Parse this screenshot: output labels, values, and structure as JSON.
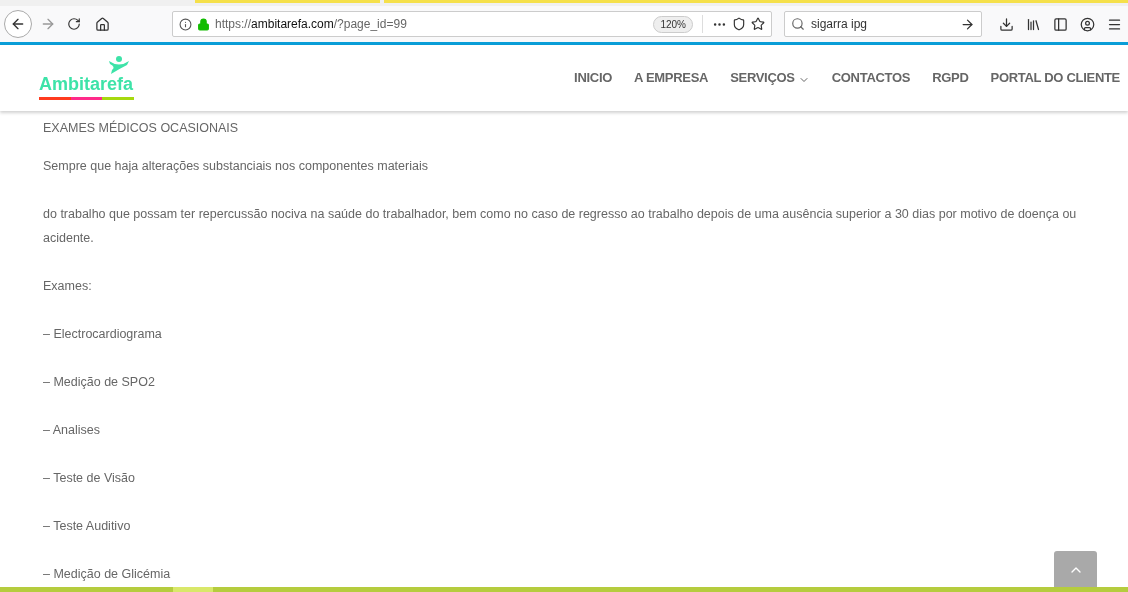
{
  "browser": {
    "url_host": "ambitarefa.com",
    "url_prefix": "https://",
    "url_path": "/?page_id=99",
    "zoom": "120%",
    "search": "sigarra ipg"
  },
  "header": {
    "logo": "Ambitarefa",
    "nav": [
      {
        "label": "INICIO",
        "dropdown": false
      },
      {
        "label": "A EMPRESA",
        "dropdown": false
      },
      {
        "label": "SERVIÇOS",
        "dropdown": true
      },
      {
        "label": "CONTACTOS",
        "dropdown": false
      },
      {
        "label": "RGPD",
        "dropdown": false
      },
      {
        "label": "PORTAL DO CLIENTE",
        "dropdown": false
      }
    ]
  },
  "content": [
    {
      "kind": "text",
      "text": "EXAMES MÉDICOS OCASIONAIS"
    },
    {
      "kind": "text",
      "text": "Sempre que haja alterações substanciais nos componentes materiais"
    },
    {
      "kind": "text",
      "text": "do trabalho que possam ter repercussão nociva na saúde do trabalhador, bem como no caso de regresso ao trabalho depois de uma ausência superior a 30 dias por motivo de doença ou acidente."
    },
    {
      "kind": "text",
      "text": "Exames:"
    },
    {
      "kind": "text",
      "text": "– Electrocardiograma"
    },
    {
      "kind": "text",
      "text": "– Medição de SPO2"
    },
    {
      "kind": "text",
      "text": "– Analises"
    },
    {
      "kind": "text",
      "text": "– Teste de Visão"
    },
    {
      "kind": "text",
      "text": "– Teste Auditivo"
    },
    {
      "kind": "text",
      "text": "– Medição de Glicémia"
    }
  ]
}
